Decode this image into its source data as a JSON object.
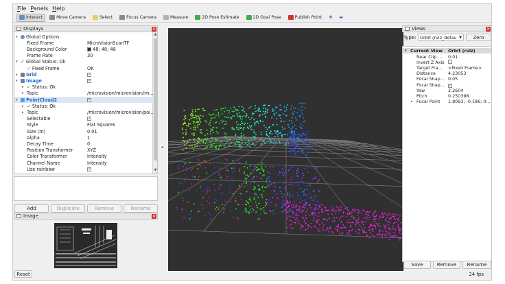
{
  "menubar": {
    "items": [
      {
        "key": "F",
        "rest": "ile"
      },
      {
        "key": "P",
        "rest": "anels"
      },
      {
        "key": "H",
        "rest": "elp"
      }
    ]
  },
  "toolbar": {
    "tools": [
      {
        "label": "Interact",
        "icon": "interact-icon",
        "color": "#6a8fc7",
        "active": true
      },
      {
        "label": "Move Camera",
        "icon": "move-camera-icon",
        "color": "#8a8a8a",
        "active": false
      },
      {
        "label": "Select",
        "icon": "select-icon",
        "color": "#e8d15a",
        "active": false
      },
      {
        "label": "Focus Camera",
        "icon": "focus-camera-icon",
        "color": "#8a8a8a",
        "active": false
      },
      {
        "label": "Measure",
        "icon": "measure-icon",
        "color": "#b0b0b0",
        "active": false
      },
      {
        "label": "2D Pose Estimate",
        "icon": "pose-estimate-icon",
        "color": "#3fae49",
        "active": false
      },
      {
        "label": "2D Goal Pose",
        "icon": "goal-pose-icon",
        "color": "#3fae49",
        "active": false
      },
      {
        "label": "Publish Point",
        "icon": "publish-point-icon",
        "color": "#d2342c",
        "active": false
      }
    ],
    "add_icon": "plus-icon",
    "remove_icon": "minus-icon"
  },
  "displays": {
    "title": "Displays",
    "rows": [
      {
        "level": 0,
        "exp": "▾",
        "icon": "globe-icon",
        "name": "Global Options",
        "value": ""
      },
      {
        "level": 1,
        "name": "Fixed Frame",
        "value": "MicroVisionScanTF"
      },
      {
        "level": 1,
        "name": "Background Color",
        "value": "48; 48; 48",
        "swatch": "#303030"
      },
      {
        "level": 1,
        "name": "Frame Rate",
        "value": "30"
      },
      {
        "level": 0,
        "exp": "▾",
        "status": "✓",
        "name": "Global Status: Ok",
        "value": ""
      },
      {
        "level": 1,
        "status": "✓",
        "name": "Fixed Frame",
        "value": "OK"
      },
      {
        "level": 0,
        "exp": "▸",
        "icon": "grid-icon",
        "name": "Grid",
        "blue": true,
        "check": true
      },
      {
        "level": 0,
        "exp": "▾",
        "icon": "image-icon",
        "name": "Image",
        "blue": true,
        "check": true
      },
      {
        "level": 1,
        "exp": "▸",
        "status": "✓",
        "name": "Status: Ok",
        "value": ""
      },
      {
        "level": 1,
        "exp": "▸",
        "name": "Topic",
        "value": "/microvision/microvision/im..."
      },
      {
        "level": 0,
        "exp": "▾",
        "icon": "pointcloud-icon",
        "name": "PointCloud2",
        "blue": true,
        "check": true,
        "selected": true
      },
      {
        "level": 1,
        "exp": "▸",
        "status": "✓",
        "name": "Status: Ok",
        "value": ""
      },
      {
        "level": 1,
        "exp": "▸",
        "name": "Topic",
        "value": "/microvision/microvision/poi..."
      },
      {
        "level": 1,
        "name": "Selectable",
        "check": true
      },
      {
        "level": 1,
        "name": "Style",
        "value": "Flat Squares"
      },
      {
        "level": 1,
        "name": "Size (m)",
        "value": "0.01"
      },
      {
        "level": 1,
        "name": "Alpha",
        "value": "1"
      },
      {
        "level": 1,
        "name": "Decay Time",
        "value": "0"
      },
      {
        "level": 1,
        "name": "Position Transformer",
        "value": "XYZ"
      },
      {
        "level": 1,
        "name": "Color Transformer",
        "value": "Intensity"
      },
      {
        "level": 1,
        "name": "Channel Name",
        "value": "Intensity"
      },
      {
        "level": 1,
        "name": "Use rainbow",
        "check": true
      }
    ],
    "buttons": {
      "add": "Add",
      "duplicate": "Duplicate",
      "remove": "Remove",
      "rename": "Rename"
    }
  },
  "image_panel": {
    "title": "Image"
  },
  "views": {
    "title": "Views",
    "type_label": "Type:",
    "type_value": "Orbit (rviz_defau",
    "zero_label": "Zero",
    "current_view": {
      "name": "Current View",
      "value": "Orbit (rviz)"
    },
    "rows": [
      {
        "name": "Near Clip ...",
        "value": "0.01"
      },
      {
        "name": "Invert Z Axis",
        "check": true
      },
      {
        "name": "Target Fra...",
        "value": "<Fixed Frame>"
      },
      {
        "name": "Distance",
        "value": "4.23053"
      },
      {
        "name": "Focal Shap...",
        "value": "0.05"
      },
      {
        "name": "Focal Shap...",
        "check": true,
        "checked": true
      },
      {
        "name": "Yaw",
        "value": "2.2604"
      },
      {
        "name": "Pitch",
        "value": "0.250398"
      },
      {
        "name": "Focal Point",
        "value": "1.8093; -0.186; 0...",
        "exp": "▸"
      }
    ],
    "buttons": {
      "save": "Save",
      "remove": "Remove",
      "rename": "Rename"
    }
  },
  "status": {
    "reset_label": "Reset",
    "fps": "24 fps"
  }
}
